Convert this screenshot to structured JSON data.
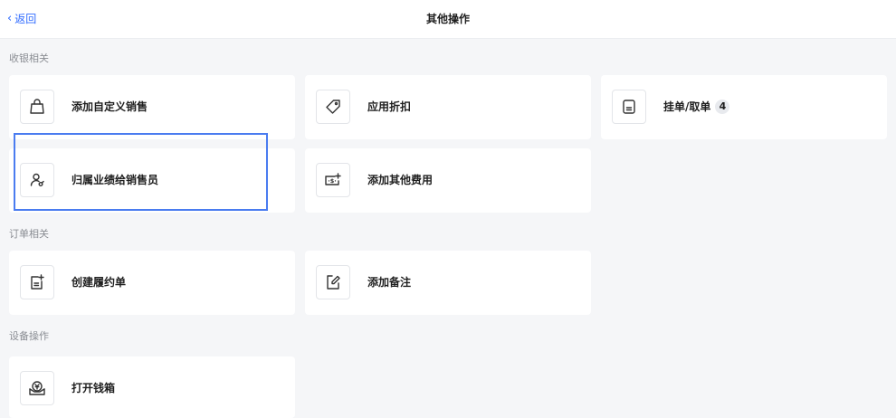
{
  "header": {
    "back_label": "返回",
    "title": "其他操作"
  },
  "sections": {
    "checkout": {
      "title": "收银相关",
      "items": {
        "custom_sale": {
          "label": "添加自定义销售",
          "icon": "shopping-bag-icon"
        },
        "discount": {
          "label": "应用折扣",
          "icon": "price-tag-icon"
        },
        "hold_order": {
          "label": "挂单/取单",
          "icon": "document-icon",
          "badge": "4"
        },
        "assign_sales": {
          "label": "归属业绩给销售员",
          "icon": "user-assign-icon"
        },
        "other_fee": {
          "label": "添加其他费用",
          "icon": "money-add-icon"
        }
      }
    },
    "order": {
      "title": "订单相关",
      "items": {
        "create_fulfillment": {
          "label": "创建履约单",
          "icon": "document-add-icon"
        },
        "add_note": {
          "label": "添加备注",
          "icon": "edit-note-icon"
        }
      }
    },
    "device": {
      "title": "设备操作",
      "items": {
        "open_cash_drawer": {
          "label": "打开钱箱",
          "icon": "cash-drawer-icon"
        }
      }
    }
  },
  "colors": {
    "accent": "#2f6bff",
    "highlight_border": "#4a7cf0",
    "background": "#f5f6f8",
    "card": "#ffffff"
  }
}
